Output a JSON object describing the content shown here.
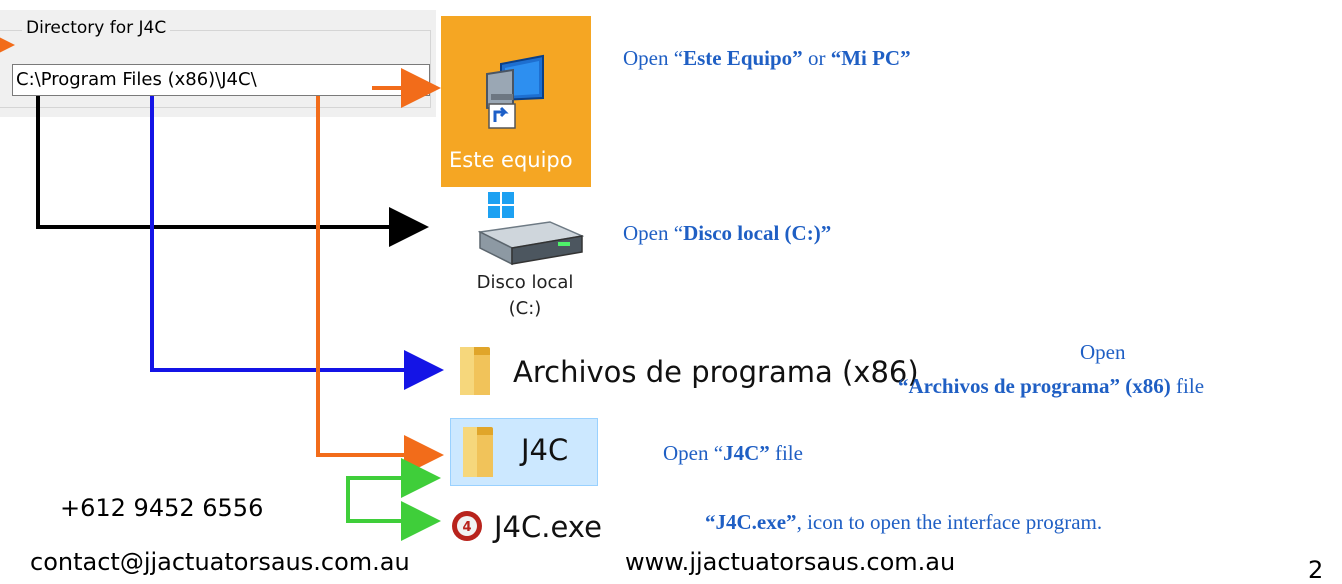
{
  "directory": {
    "legend": "Directory for J4C",
    "path": "C:\\Program Files (x86)\\J4C\\"
  },
  "pc": {
    "label": "Este equipo",
    "caption_pre": "Open “",
    "caption_name1": "Este Equipo”",
    "caption_mid": " or ",
    "caption_name2": "“Mi PC”"
  },
  "disk": {
    "label_line1": "Disco local",
    "label_line2": "(C:)",
    "caption_pre": "Open “",
    "caption_name": "Disco local (C:)”"
  },
  "program_files": {
    "label": "Archivos de programa (x86)",
    "caption_line1": "Open",
    "caption_name": "“Archivos de programa” (x86)",
    "caption_suffix": " file"
  },
  "j4c_folder": {
    "label": "J4C",
    "caption_pre": "Open “",
    "caption_name": "J4C”",
    "caption_suffix": " file"
  },
  "j4c_exe": {
    "label": "J4C.exe",
    "caption_name": "“J4C.exe”",
    "caption_suffix": ", icon to open the interface program."
  },
  "footer": {
    "phone": "+612 9452 6556",
    "email": "contact@jjactuatorsaus.com.au",
    "website": "www.jjactuatorsaus.com.au",
    "page_number": "2"
  },
  "colors": {
    "orange": "#f26c1a",
    "black": "#000000",
    "blue": "#1414e6",
    "green": "#3fce3a",
    "caption_blue": "#1f5fc4",
    "tile_orange": "#f5a623"
  }
}
